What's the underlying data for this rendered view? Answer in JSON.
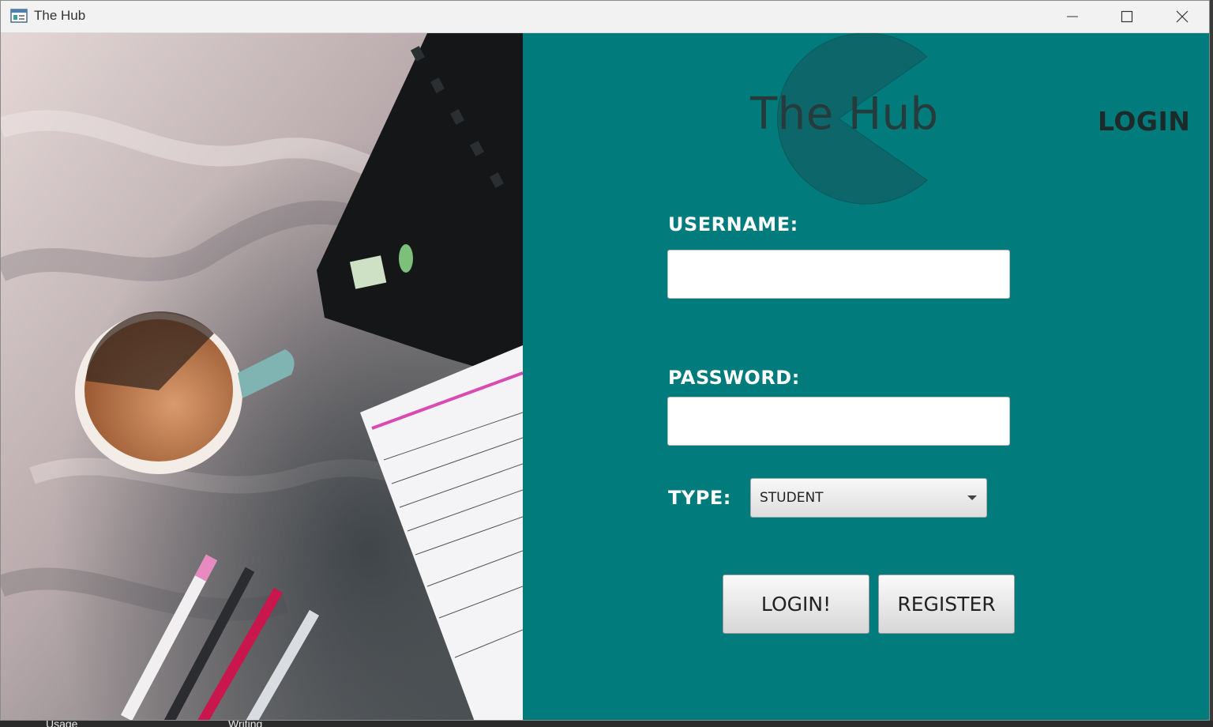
{
  "window": {
    "title": "The Hub"
  },
  "brand": {
    "title": "The Hub",
    "logo_color": "#0d6669"
  },
  "page": {
    "heading": "LOGIN"
  },
  "form": {
    "username_label": "USERNAME:",
    "username_value": "",
    "password_label": "PASSWORD:",
    "password_value": "",
    "type_label": "TYPE:",
    "type_selected": "STUDENT"
  },
  "buttons": {
    "login": "LOGIN!",
    "register": "REGISTER"
  },
  "background_items": [
    "Usage",
    "Writing"
  ],
  "colors": {
    "panel": "#017b7b",
    "heading": "#1c2a2a",
    "label": "#ffffff"
  },
  "icons": [
    "app-window-icon",
    "minimize-icon",
    "maximize-icon",
    "close-icon",
    "dropdown-arrow-icon"
  ]
}
